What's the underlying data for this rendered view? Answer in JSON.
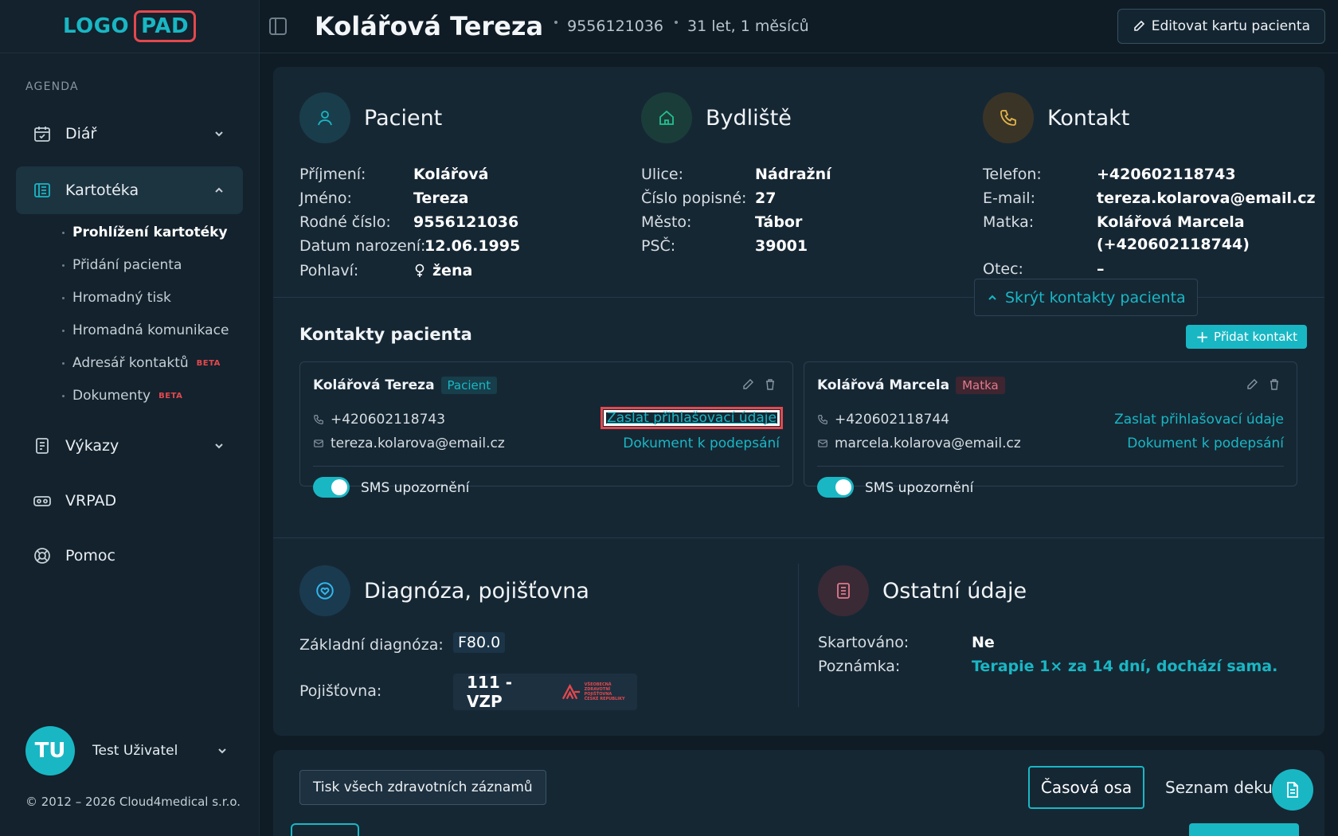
{
  "logo": {
    "part1": "LOGO",
    "part2": "PAD"
  },
  "sidebar": {
    "section": "AGENDA",
    "items": [
      {
        "label": "Diář"
      },
      {
        "label": "Kartotéka"
      },
      {
        "label": "Výkazy"
      },
      {
        "label": "VRPAD"
      },
      {
        "label": "Pomoc"
      }
    ],
    "subitems": [
      {
        "label": "Prohlížení kartotéky"
      },
      {
        "label": "Přidání pacienta"
      },
      {
        "label": "Hromadný tisk"
      },
      {
        "label": "Hromadná komunikace"
      },
      {
        "label": "Adresář kontaktů",
        "badge": "BETA"
      },
      {
        "label": "Dokumenty",
        "badge": "BETA"
      }
    ],
    "user": {
      "initials": "TU",
      "name": "Test Uživatel"
    },
    "copyright": "© 2012 – 2026 Cloud4medical s.r.o."
  },
  "header": {
    "name": "Kolářová Tereza",
    "id": "9556121036",
    "age": "31 let, 1 měsíců",
    "edit_label": "Editovat kartu pacienta"
  },
  "patient": {
    "title": "Pacient",
    "fields": [
      {
        "k": "Příjmení:",
        "v": "Kolářová"
      },
      {
        "k": "Jméno:",
        "v": "Tereza"
      },
      {
        "k": "Rodné číslo:",
        "v": "9556121036"
      },
      {
        "k": "Datum narození:",
        "v": "12.06.1995"
      },
      {
        "k": "Pohlaví:",
        "v": "žena"
      }
    ]
  },
  "address": {
    "title": "Bydliště",
    "fields": [
      {
        "k": "Ulice:",
        "v": "Nádražní"
      },
      {
        "k": "Číslo popisné:",
        "v": "27"
      },
      {
        "k": "Město:",
        "v": "Tábor"
      },
      {
        "k": "PSČ:",
        "v": "39001"
      }
    ]
  },
  "contact": {
    "title": "Kontakt",
    "fields": [
      {
        "k": "Telefon:",
        "v": "+420602118743"
      },
      {
        "k": "E-mail:",
        "v": "tereza.kolarova@email.cz"
      },
      {
        "k": "Matka:",
        "v": "Kolářová Marcela",
        "v2": "(+420602118744)"
      },
      {
        "k": "Otec:",
        "v": "–"
      }
    ],
    "hide_label": "Skrýt kontakty pacienta"
  },
  "contacts_section": {
    "title": "Kontakty pacienta",
    "add_label": "Přidat kontakt",
    "cards": [
      {
        "name": "Kolářová Tereza",
        "tag": "Pacient",
        "phone": "+420602118743",
        "email": "tereza.kolarova@email.cz",
        "link1": "Zaslat přihlašovací údaje",
        "link2": "Dokument k podepsání",
        "sms": "SMS upozornění"
      },
      {
        "name": "Kolářová Marcela",
        "tag": "Matka",
        "phone": "+420602118744",
        "email": "marcela.kolarova@email.cz",
        "link1": "Zaslat přihlašovací údaje",
        "link2": "Dokument k podepsání",
        "sms": "SMS upozornění"
      }
    ]
  },
  "diagnosis": {
    "title": "Diagnóza, pojišťovna",
    "dx_label": "Základní diagnóza:",
    "dx_value": "F80.0",
    "ins_label": "Pojišťovna:",
    "ins_value": "111 - VZP",
    "ins_logo_text": [
      "VŠEOBECNÁ",
      "ZDRAVOTNÍ POJIŠŤOVNA",
      "ČESKÉ REPUBLIKY"
    ]
  },
  "other": {
    "title": "Ostatní údaje",
    "shred_label": "Skartováno:",
    "shred_value": "Ne",
    "note_label": "Poznámka:",
    "note_value": "Terapie 1× za 14 dní, dochází sama."
  },
  "bottom": {
    "print_label": "Tisk všech zdravotních záznamů",
    "timeline_label": "Časová osa",
    "list_label": "Seznam dekurzů"
  }
}
